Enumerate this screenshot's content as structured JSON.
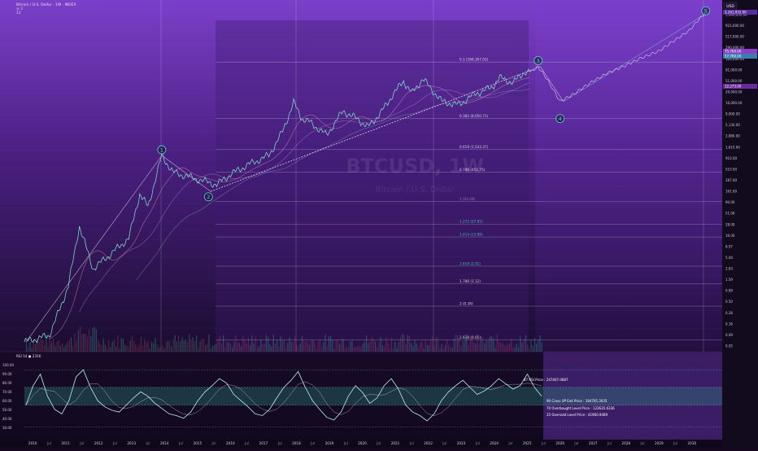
{
  "header": {
    "symbol_line": "Bitcoin / U.S. Dollar · 1W · INDEX",
    "ohlc_line": "◎ 2",
    "sub_line": "14",
    "currency": "USD"
  },
  "watermark": {
    "ticker": "BTCUSD, 1W",
    "subtitle": "Bitcoin / U.S. Dollar"
  },
  "colors": {
    "background_top": "#7a3fc8",
    "background_bottom": "#0e0818",
    "price_line": "#7fd3c6",
    "ma_pink": "#d98ab0",
    "wave_label": "#5fcfc0",
    "fib_text": "#e8e0f0",
    "fib_teal": "#3fd0c0",
    "rsi_line": "#b9f0e6",
    "rsi_fill": "#2b8c84",
    "highlight_box": "#6a2aaa"
  },
  "chart_data": {
    "type": "line",
    "title": "BTCUSD, 1W",
    "yscale": "log",
    "ylim": [
      0.04,
      3000000
    ],
    "xlim": [
      "2009-10",
      "2030-12"
    ],
    "price_series": {
      "name": "BTCUSD",
      "points": [
        [
          "2009-10",
          0.05
        ],
        [
          "2010-07",
          0.07
        ],
        [
          "2010-11",
          0.3
        ],
        [
          "2011-02",
          1
        ],
        [
          "2011-06",
          25
        ],
        [
          "2011-11",
          2.5
        ],
        [
          "2012-06",
          6
        ],
        [
          "2012-12",
          13
        ],
        [
          "2013-04",
          140
        ],
        [
          "2013-07",
          70
        ],
        [
          "2013-12",
          1100
        ],
        [
          "2014-04",
          450
        ],
        [
          "2014-12",
          320
        ],
        [
          "2015-08",
          230
        ],
        [
          "2016-01",
          400
        ],
        [
          "2016-07",
          650
        ],
        [
          "2017-03",
          1100
        ],
        [
          "2017-08",
          4000
        ],
        [
          "2017-12",
          19000
        ],
        [
          "2018-03",
          8000
        ],
        [
          "2018-06",
          6500
        ],
        [
          "2018-12",
          3300
        ],
        [
          "2019-06",
          12000
        ],
        [
          "2019-12",
          7200
        ],
        [
          "2020-03",
          5000
        ],
        [
          "2020-08",
          11500
        ],
        [
          "2020-12",
          28000
        ],
        [
          "2021-04",
          60000
        ],
        [
          "2021-07",
          31000
        ],
        [
          "2021-11",
          67000
        ],
        [
          "2022-06",
          20000
        ],
        [
          "2022-12",
          16500
        ],
        [
          "2023-06",
          30000
        ],
        [
          "2023-12",
          42000
        ],
        [
          "2024-03",
          71000
        ],
        [
          "2024-08",
          55000
        ],
        [
          "2024-12",
          99000
        ],
        [
          "2025-02",
          96000
        ]
      ]
    },
    "projection_series": {
      "name": "Projection",
      "points": [
        [
          "2025-02",
          96000
        ],
        [
          "2025-05",
          130000
        ],
        [
          "2025-08",
          70000
        ],
        [
          "2026-01",
          20000
        ],
        [
          "2026-06",
          30000
        ],
        [
          "2027-01",
          60000
        ],
        [
          "2027-06",
          90000
        ],
        [
          "2028-01",
          140000
        ],
        [
          "2028-06",
          200000
        ],
        [
          "2029-01",
          300000
        ],
        [
          "2029-06",
          500000
        ],
        [
          "2029-12",
          900000
        ],
        [
          "2030-03",
          1500000
        ],
        [
          "2030-06",
          2400000
        ]
      ]
    },
    "wave_labels": [
      {
        "label": "1",
        "date": "2013-12",
        "price": 1500
      },
      {
        "label": "2",
        "date": "2015-05",
        "price": 120
      },
      {
        "label": "3",
        "date": "2025-05",
        "price": 180000
      },
      {
        "label": "4",
        "date": "2026-01",
        "price": 8000
      },
      {
        "label": "5",
        "date": "2030-06",
        "price": 2600000
      }
    ],
    "fib_levels": [
      {
        "label": "0.1 (166,307.03)",
        "price": 166307
      },
      {
        "label": "0.382 (8,050.71)",
        "price": 8050
      },
      {
        "label": "0.618 (1,543.37)",
        "price": 1543
      },
      {
        "label": "0.786 (451.75)",
        "price": 451
      },
      {
        "label": "1 (93.08)",
        "price": 93
      },
      {
        "label": "1.272 (27.81)",
        "price": 27.8
      },
      {
        "label": "1.414 (13.88)",
        "price": 13.9
      },
      {
        "label": "1.618 (2.91)",
        "price": 2.9
      },
      {
        "label": "1.786 (1.12)",
        "price": 1.12
      },
      {
        "label": "2 (0.34)",
        "price": 0.34
      },
      {
        "label": "2.618 (0.01)",
        "price": 0.055
      }
    ],
    "right_axis_ticks": [
      "1,640,000.00",
      "921,000.00",
      "517,000.00",
      "290,000.00",
      "163,000.00",
      "91,000.00",
      "51,000.00",
      "29,000.00",
      "16,000.00",
      "9,000.00",
      "5,130.00",
      "2,880.00",
      "1,610.00",
      "910.00",
      "510.00",
      "287.00",
      "161.00",
      "90.00",
      "51.00",
      "28.00",
      "16.00",
      "8.97",
      "5.04",
      "2.83",
      "1.59",
      "0.89",
      "0.50",
      "0.28",
      "0.16",
      "0.09",
      "0.05"
    ],
    "price_badges": [
      "2,261,932.00",
      "75,760.00",
      "57,760.00",
      "12,273.00"
    ],
    "x_tick_labels": [
      "2010",
      "Jul",
      "2011",
      "Jul",
      "2012",
      "Jul",
      "2013",
      "Jul",
      "2014",
      "Jul",
      "2015",
      "Jul",
      "2016",
      "Jul",
      "2017",
      "Jul",
      "2018",
      "Jul",
      "2019",
      "Jul",
      "2020",
      "Jul",
      "2021",
      "Jul",
      "2022",
      "Jul",
      "2023",
      "Jul",
      "2024",
      "Jul",
      "2025",
      "Jul",
      "2026",
      "Jul",
      "2027",
      "Jul",
      "2028",
      "Jul",
      "2029",
      "Jul",
      "2030"
    ],
    "rsi_panel": {
      "title": "RSI 14 ● 2316",
      "axis_ticks": [
        "100.00",
        "90.00",
        "80.00",
        "70.00",
        "60.00",
        "50.00",
        "40.00",
        "30.00"
      ],
      "annotations": [
        "87 RSI Price : 247407.0687",
        "90 Cross UP Exit Price : 184705.3035",
        "70 Overbought Level Price : 123635.6336",
        "25 Oversold Level Price : 41960.9469"
      ],
      "values": [
        50,
        72,
        85,
        60,
        45,
        40,
        55,
        82,
        90,
        70,
        55,
        48,
        44,
        42,
        50,
        58,
        65,
        60,
        52,
        46,
        40,
        38,
        35,
        42,
        55,
        65,
        72,
        80,
        75,
        62,
        55,
        48,
        40,
        38,
        45,
        58,
        70,
        78,
        88,
        70,
        55,
        45,
        36,
        33,
        42,
        60,
        72,
        64,
        52,
        58,
        72,
        80,
        68,
        50,
        42,
        38,
        32,
        40,
        55,
        65,
        72,
        78,
        70,
        62,
        66,
        72,
        80,
        74,
        68,
        72,
        85,
        70,
        60
      ]
    }
  }
}
